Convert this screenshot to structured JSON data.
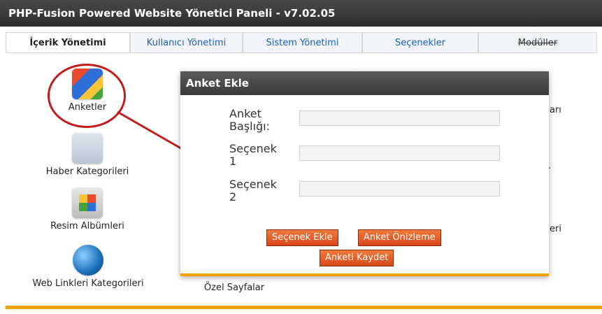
{
  "window": {
    "title": "PHP-Fusion Powered Website Yönetici Paneli - v7.02.05"
  },
  "tabs": [
    {
      "label": "İçerik Yönetimi"
    },
    {
      "label": "Kullanıcı Yönetimi"
    },
    {
      "label": "Sistem Yönetimi"
    },
    {
      "label": "Seçenekler"
    },
    {
      "label": "Modüller"
    }
  ],
  "items": {
    "anketler": "Anketler",
    "haber_kategorileri": "Haber Kategorileri",
    "resim_albumleri": "Resim Albümleri",
    "web_linkleri_kategorileri": "Web Linkleri Kategorileri",
    "ozel_sayfalar": "Özel Sayfalar"
  },
  "background_fragments": {
    "right1": "arı",
    "right2": ".",
    "right3": "eri"
  },
  "modal": {
    "title": "Anket Ekle",
    "fields": [
      {
        "label_line1": "Anket",
        "label_line2": "Başlığı:",
        "value": ""
      },
      {
        "label_line1": "Seçenek",
        "label_line2": "1",
        "value": ""
      },
      {
        "label_line1": "Seçenek",
        "label_line2": "2",
        "value": ""
      }
    ],
    "buttons": {
      "add_option": "Seçenek Ekle",
      "preview": "Anket Önizleme",
      "save": "Anketi Kaydet"
    }
  },
  "colors": {
    "accent": "#f5a000",
    "annotation": "#c11c1c",
    "button": "#e05a24"
  },
  "icons": [
    "poll-icon",
    "news-category-icon",
    "photo-album-icon",
    "web-links-icon"
  ]
}
